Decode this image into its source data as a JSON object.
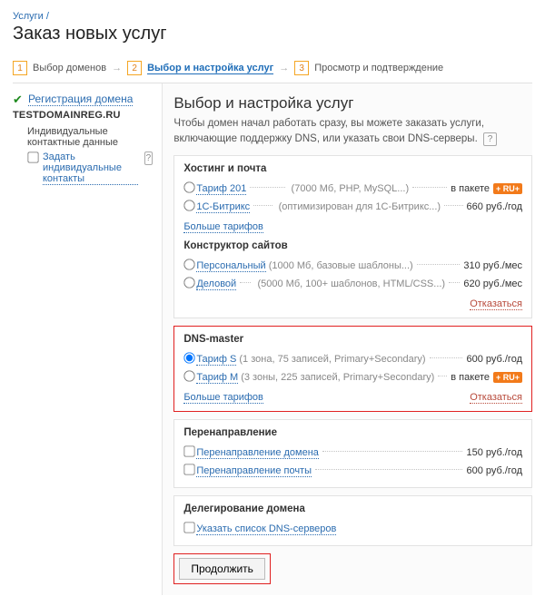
{
  "breadcrumb": {
    "root": "Услуги",
    "sep": "/"
  },
  "page_title": "Заказ новых услуг",
  "steps": {
    "s1": {
      "n": "1",
      "label": "Выбор доменов"
    },
    "s2": {
      "n": "2",
      "label": "Выбор и настройка услуг"
    },
    "s3": {
      "n": "3",
      "label": "Просмотр и подтверждение"
    },
    "arrow": "→"
  },
  "left": {
    "domain_reg_label": "Регистрация домена",
    "domain_name": "TESTDOMAINREG.RU",
    "contacts_heading": "Индивидуальные контактные данные",
    "contacts_checkbox_label": "Задать индивидуальные контакты"
  },
  "right": {
    "heading": "Выбор и настройка услуг",
    "intro": "Чтобы домен начал работать сразу, вы можете заказать услуги, включающие поддержку DNS, или указать свои DNS-серверы.",
    "help": "?",
    "badge_text": "+ RU+"
  },
  "hosting": {
    "title": "Хостинг и почта",
    "items": [
      {
        "name": "Тариф 201",
        "desc": "(7000 Мб, PHP, MySQL...)",
        "price_label": "в пакете",
        "badge": true
      },
      {
        "name": "1С-Битрикс",
        "desc": "(оптимизирован для 1С-Битрикс...)",
        "price_label": "660  руб./год"
      }
    ],
    "more": "Больше тарифов"
  },
  "builder": {
    "title": "Конструктор сайтов",
    "items": [
      {
        "name": "Персональный",
        "desc": "(1000 Мб, базовые шаблоны...)",
        "price_label": "310  руб./мес"
      },
      {
        "name": "Деловой",
        "desc": "(5000 Мб, 100+ шаблонов, HTML/CSS...)",
        "price_label": "620  руб./мес"
      }
    ],
    "decline": "Отказаться"
  },
  "dns": {
    "title": "DNS-master",
    "items": [
      {
        "name": "Тариф S",
        "desc": "(1 зона, 75 записей, Primary+Secondary)",
        "price_label": "600 руб./год",
        "checked": true
      },
      {
        "name": "Тариф M",
        "desc": "(3 зоны, 225 записей, Primary+Secondary)",
        "price_label": "в пакете",
        "badge": true
      }
    ],
    "more": "Больше тарифов",
    "decline": "Отказаться"
  },
  "redirect": {
    "title": "Перенаправление",
    "items": [
      {
        "name": "Перенаправление домена",
        "price_label": "150 руб./год"
      },
      {
        "name": "Перенаправление почты",
        "price_label": "600 руб./год"
      }
    ]
  },
  "delegation": {
    "title": "Делегирование домена",
    "item": "Указать список DNS-серверов"
  },
  "continue_label": "Продолжить"
}
